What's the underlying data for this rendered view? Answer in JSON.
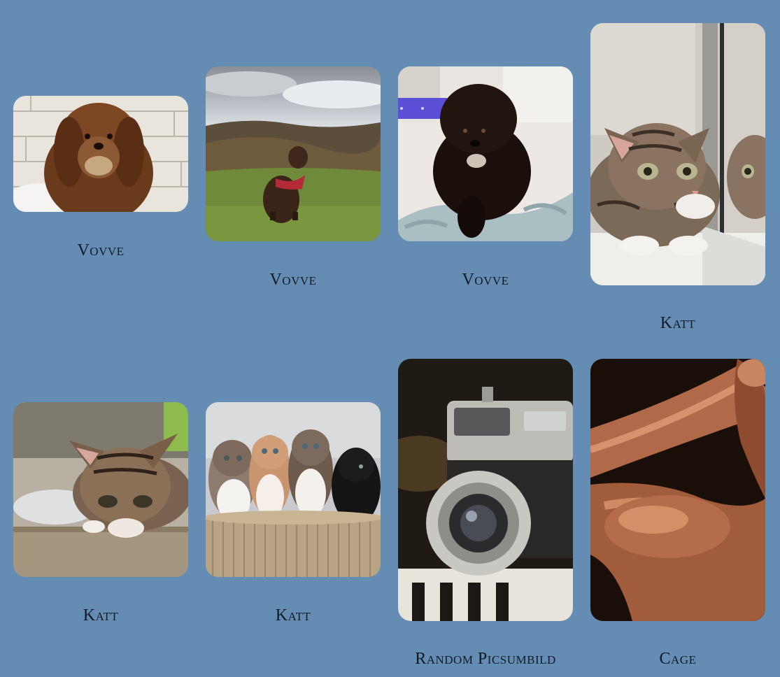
{
  "gallery": {
    "items": [
      {
        "caption": "Vovve",
        "icon": "curly-brown-dog-photo"
      },
      {
        "caption": "Vovve",
        "icon": "dog-on-hillside-photo"
      },
      {
        "caption": "Vovve",
        "icon": "black-puppy-photo"
      },
      {
        "caption": "Katt",
        "icon": "tabby-kitten-mirror-photo"
      },
      {
        "caption": "Katt",
        "icon": "tabby-kitten-photo"
      },
      {
        "caption": "Katt",
        "icon": "kittens-in-basket-photo"
      },
      {
        "caption": "Random Picsumbild",
        "icon": "vintage-camera-photo"
      },
      {
        "caption": "Cage",
        "icon": "flexing-arm-photo"
      }
    ]
  },
  "colors": {
    "background": "#658db3",
    "caption_text": "#0e1a26"
  }
}
